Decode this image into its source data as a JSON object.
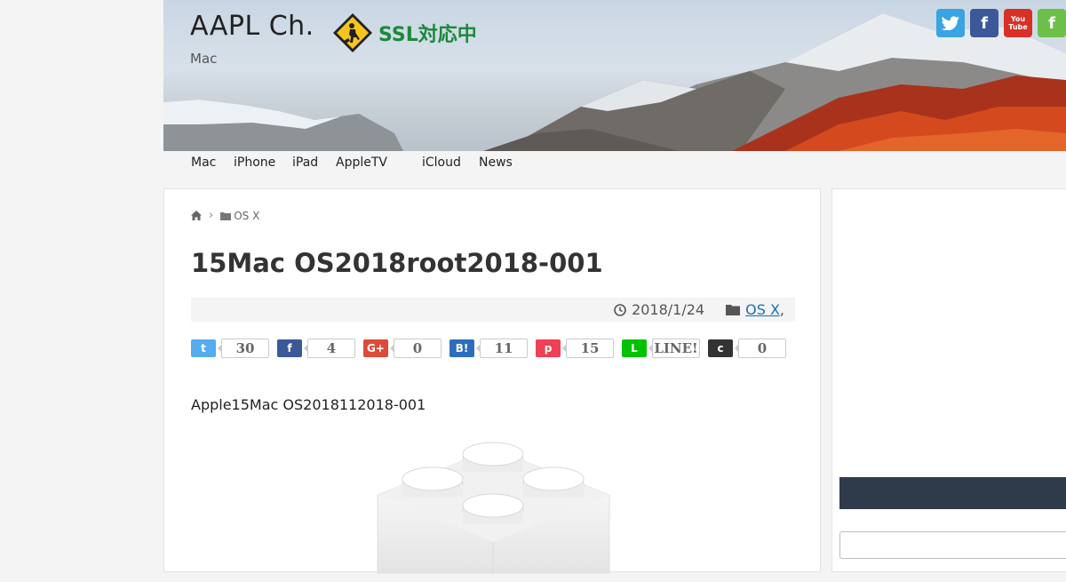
{
  "site": {
    "title": "AAPL Ch.",
    "subtitle": "Mac",
    "ssl_badge": "SSL対応中"
  },
  "social": [
    {
      "name": "twitter-icon",
      "glyph": "t",
      "color": "#3aa3e3"
    },
    {
      "name": "facebook-icon",
      "glyph": "f",
      "color": "#3b5998"
    },
    {
      "name": "youtube-icon",
      "glyph": "You Tube",
      "color": "#d93025"
    },
    {
      "name": "feedly-icon",
      "glyph": "f",
      "color": "#6cc04a"
    }
  ],
  "nav": {
    "items": [
      "Mac",
      "iPhone",
      "iPad",
      "AppleTV",
      "iCloud",
      "News"
    ]
  },
  "breadcrumb": {
    "home_icon": "home-icon",
    "category": "OS X"
  },
  "article": {
    "title": "15Mac OS2018root2018-001",
    "date": "2018/1/24",
    "category": "OS X",
    "category_suffix": ",",
    "intro": "Apple15Mac OS2018112018-001"
  },
  "shares": [
    {
      "name": "twitter",
      "label": "t",
      "count": "30",
      "color": "#55acee"
    },
    {
      "name": "facebook",
      "label": "f",
      "count": "4",
      "color": "#3b5998"
    },
    {
      "name": "googleplus",
      "label": "G+",
      "count": "0",
      "color": "#dd4b39"
    },
    {
      "name": "hatena",
      "label": "B!",
      "count": "11",
      "color": "#2c6ebd"
    },
    {
      "name": "pocket",
      "label": "p",
      "count": "15",
      "color": "#ef4056"
    },
    {
      "name": "line",
      "label": "L",
      "count": "LINE!",
      "color": "#00c300"
    },
    {
      "name": "comment",
      "label": "c",
      "count": "0",
      "color": "#333333"
    }
  ]
}
